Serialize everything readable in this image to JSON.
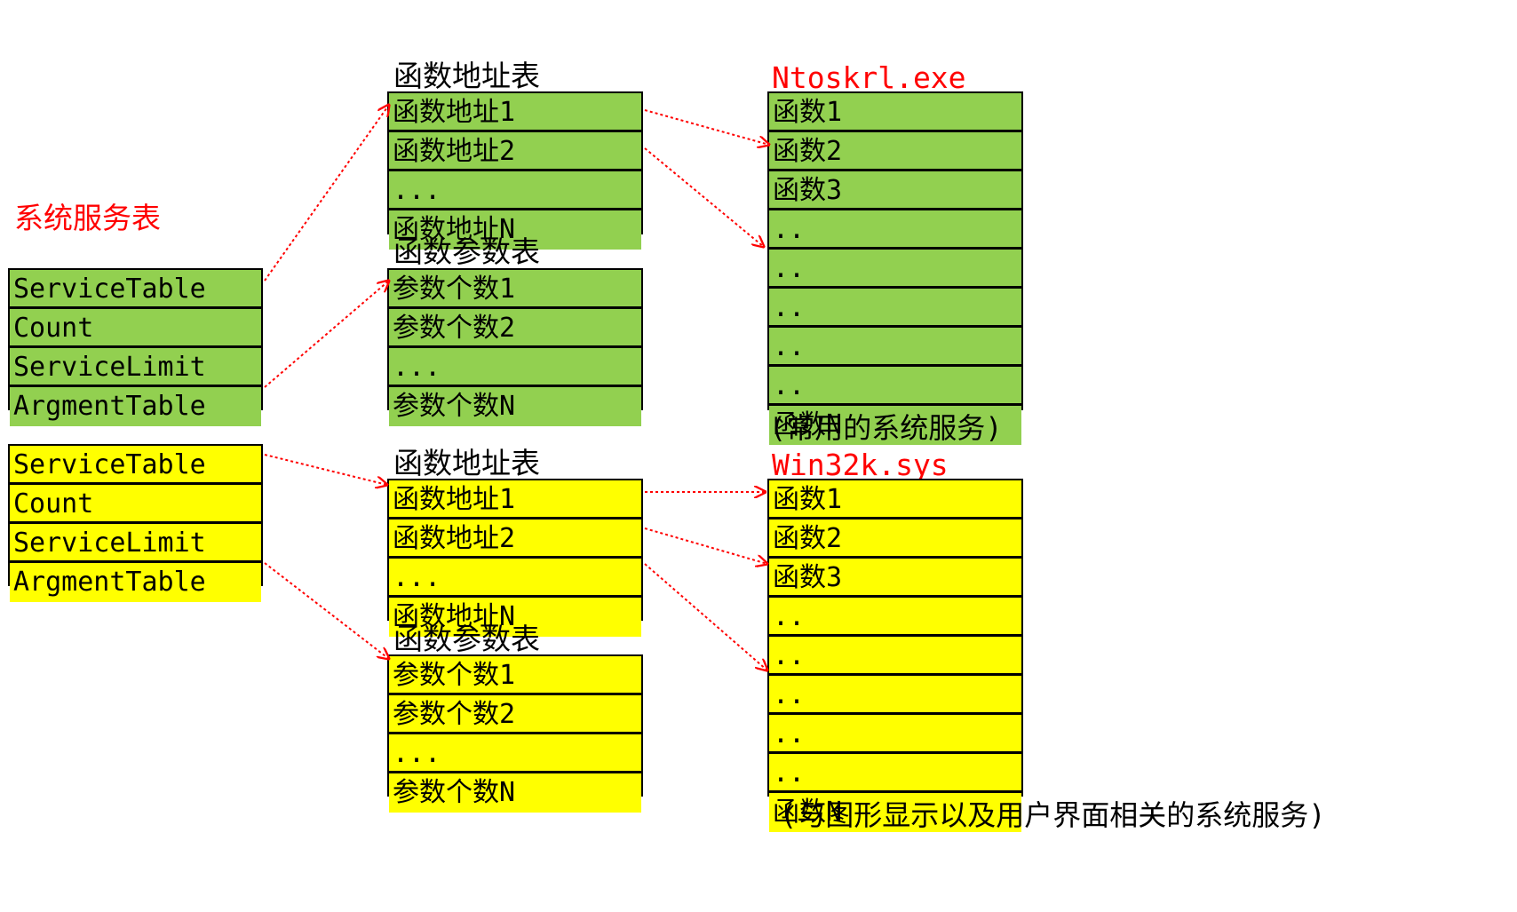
{
  "system_service_table_title": "系统服务表",
  "sst_green": [
    "ServiceTable",
    "Count",
    "ServiceLimit",
    "ArgmentTable"
  ],
  "sst_yellow": [
    "ServiceTable",
    "Count",
    "ServiceLimit",
    "ArgmentTable"
  ],
  "top": {
    "addr_table_title": "函数地址表",
    "addr_rows": [
      "函数地址1",
      "函数地址2",
      "...",
      "函数地址N"
    ],
    "param_table_title": "函数参数表",
    "param_rows": [
      "参数个数1",
      "参数个数2",
      "...",
      "参数个数N"
    ],
    "module_title": "Ntoskrl.exe",
    "module_rows": [
      "函数1",
      "函数2",
      "函数3",
      "..",
      "..",
      "..",
      "..",
      "..",
      "函数N"
    ],
    "module_note": "(常用的系统服务)"
  },
  "bottom": {
    "addr_table_title": "函数地址表",
    "addr_rows": [
      "函数地址1",
      "函数地址2",
      "...",
      "函数地址N"
    ],
    "param_table_title": "函数参数表",
    "param_rows": [
      "参数个数1",
      "参数个数2",
      "...",
      "参数个数N"
    ],
    "module_title": "Win32k.sys",
    "module_rows": [
      "函数1",
      "函数2",
      "函数3",
      "..",
      "..",
      "..",
      "..",
      "..",
      "函数N"
    ],
    "module_note": "(与图形显示以及用户界面相关的系统服务)"
  },
  "colors": {
    "green": "#92d050",
    "yellow": "#ffff00",
    "arrow": "#ff0000",
    "title_red": "#ff0000"
  }
}
